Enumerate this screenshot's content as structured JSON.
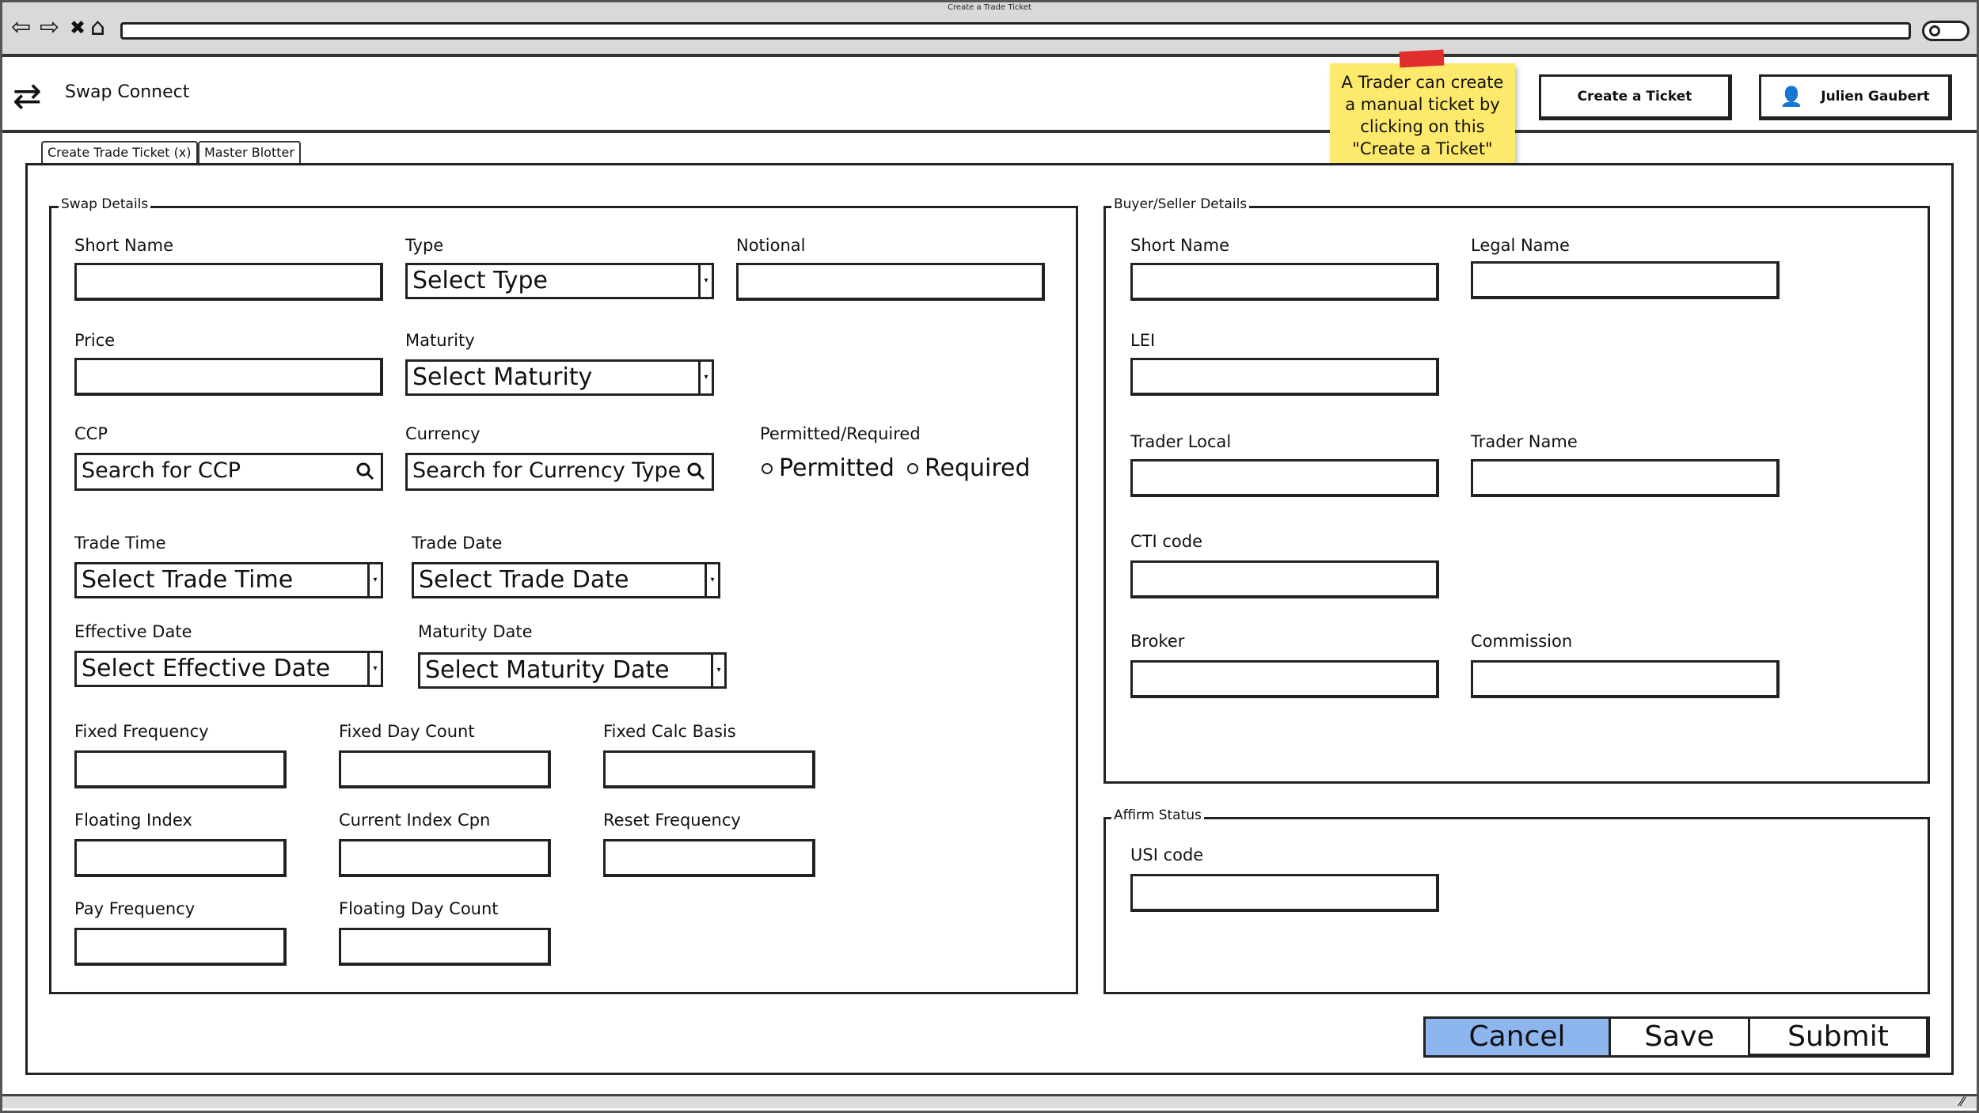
{
  "browser": {
    "window_title": "Create a Trade Ticket",
    "back_icon": "⇦",
    "forward_icon": "⇨",
    "stop_icon": "✖",
    "home_icon": "⌂"
  },
  "app": {
    "logo_icon": "⇄",
    "name": "Swap Connect",
    "create_ticket_label": "Create a Ticket",
    "user_name": "Julien Gaubert",
    "user_icon": "👤"
  },
  "sticky_note": {
    "text": "A Trader can create a manual ticket by clicking on this \"Create a Ticket\" button here."
  },
  "tabs": [
    {
      "label": "Create Trade Ticket (x)"
    },
    {
      "label": "Master Blotter"
    }
  ],
  "swap_details": {
    "title": "Swap Details",
    "short_name_label": "Short Name",
    "type_label": "Type",
    "type_value": "Select Type",
    "notional_label": "Notional",
    "price_label": "Price",
    "maturity_label": "Maturity",
    "maturity_value": "Select Maturity",
    "ccp_label": "CCP",
    "ccp_placeholder": "Search for CCP",
    "currency_label": "Currency",
    "currency_placeholder": "Search for Currency Type",
    "permitted_required_label": "Permitted/Required",
    "permitted_option": "Permitted",
    "required_option": "Required",
    "trade_time_label": "Trade Time",
    "trade_time_value": "Select Trade Time",
    "trade_date_label": "Trade Date",
    "trade_date_value": "Select Trade Date",
    "effective_date_label": "Effective Date",
    "effective_date_value": "Select Effective Date",
    "maturity_date_label": "Maturity Date",
    "maturity_date_value": "Select Maturity Date",
    "fixed_frequency_label": "Fixed Frequency",
    "fixed_day_count_label": "Fixed Day Count",
    "fixed_calc_basis_label": "Fixed Calc Basis",
    "floating_index_label": "Floating Index",
    "current_index_cpn_label": "Current Index Cpn",
    "reset_frequency_label": "Reset Frequency",
    "pay_frequency_label": "Pay Frequency",
    "floating_day_count_label": "Floating Day Count"
  },
  "buyer_seller": {
    "title": "Buyer/Seller Details",
    "short_name_label": "Short Name",
    "legal_name_label": "Legal Name",
    "lei_label": "LEI",
    "trader_local_label": "Trader Local",
    "trader_name_label": "Trader Name",
    "cti_code_label": "CTI code",
    "broker_label": "Broker",
    "commission_label": "Commission"
  },
  "affirm_status": {
    "title": "Affirm Status",
    "usi_code_label": "USI code"
  },
  "actions": {
    "cancel": "Cancel",
    "save": "Save",
    "submit": "Submit"
  },
  "colors": {
    "sticky": "#fde96b",
    "cancel": "#8db5ee",
    "tape": "#e02d2d"
  }
}
